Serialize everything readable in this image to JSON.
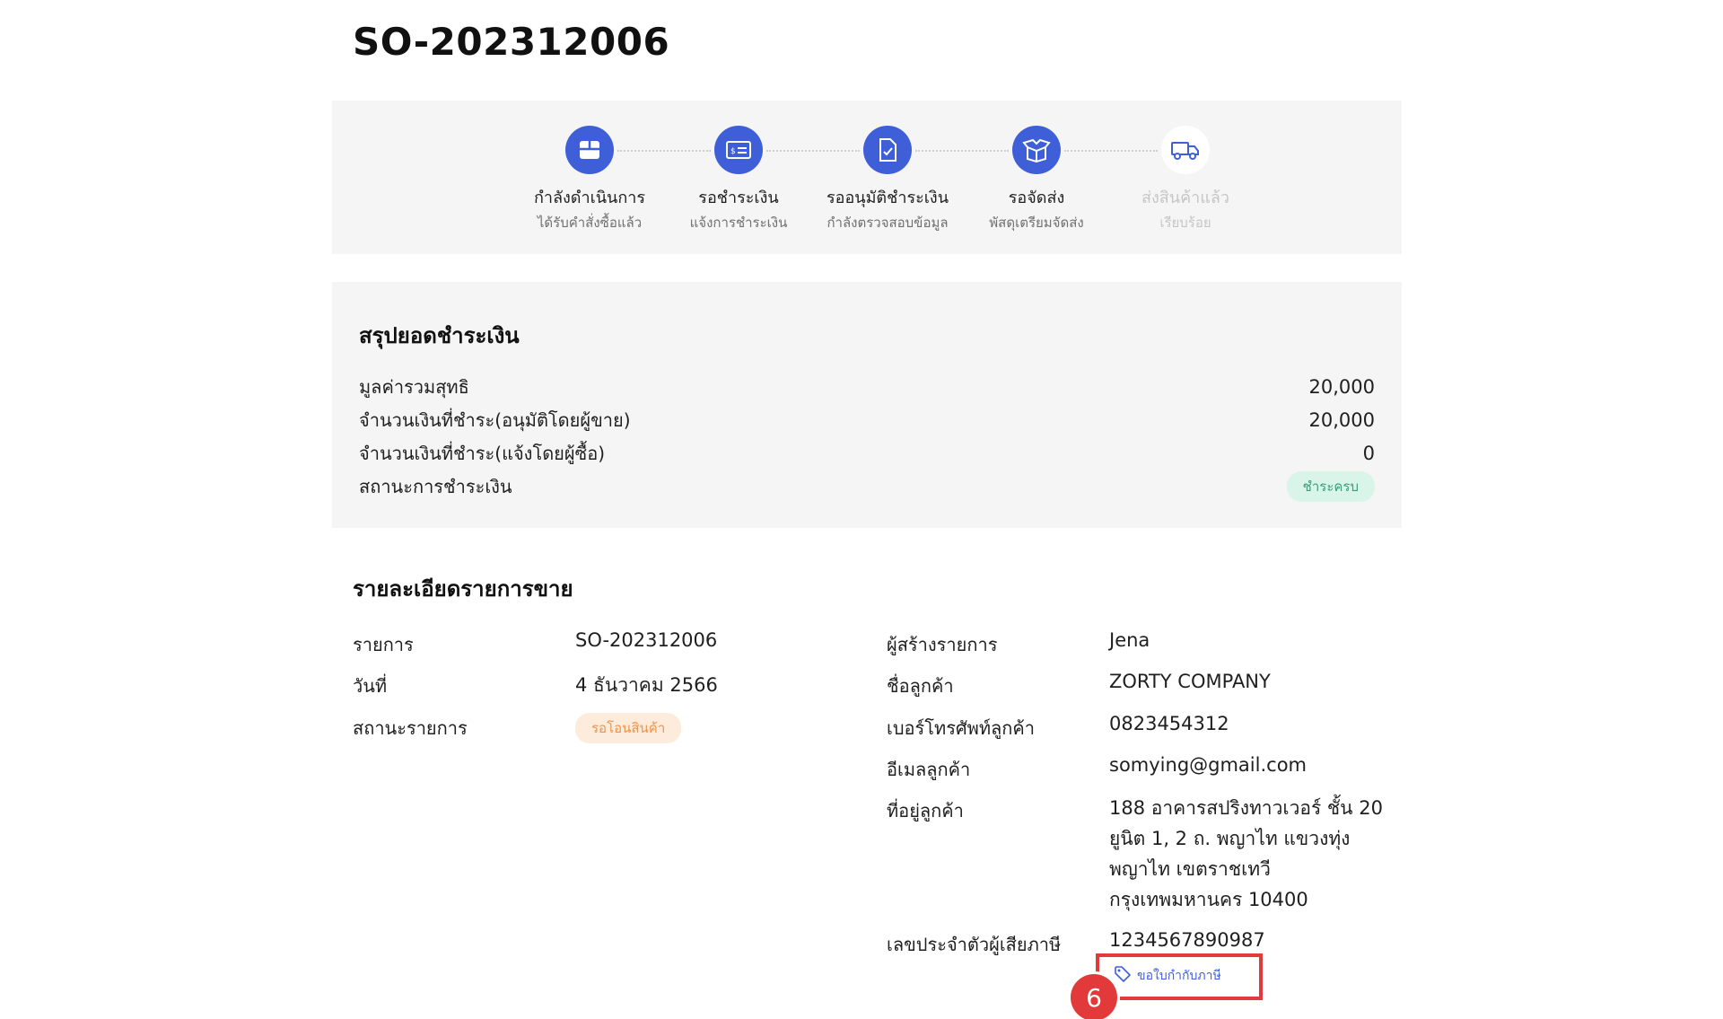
{
  "page": {
    "title": "SO-202312006"
  },
  "stepper": {
    "steps": [
      {
        "title": "กำลังดำเนินการ",
        "subtitle": "ได้รับคำสั่งซื้อแล้ว",
        "icon": "box-icon",
        "active": true
      },
      {
        "title": "รอชำระเงิน",
        "subtitle": "แจ้งการชำระเงิน",
        "icon": "payment-card-icon",
        "active": true
      },
      {
        "title": "รออนุมัติชำระเงิน",
        "subtitle": "กำลังตรวจสอบข้อมูล",
        "icon": "document-check-icon",
        "active": true
      },
      {
        "title": "รอจัดส่ง",
        "subtitle": "พัสดุเตรียมจัดส่ง",
        "icon": "open-box-icon",
        "active": true
      },
      {
        "title": "ส่งสินค้าแล้ว",
        "subtitle": "เรียบร้อย",
        "icon": "truck-icon",
        "active": false
      }
    ]
  },
  "summary": {
    "title": "สรุปยอดชำระเงิน",
    "rows": [
      {
        "label": "มูลค่ารวมสุทธิ",
        "value": "20,000"
      },
      {
        "label": "จำนวนเงินที่ชำระ(อนุมัติโดยผู้ขาย)",
        "value": "20,000"
      },
      {
        "label": "จำนวนเงินที่ชำระ(แจ้งโดยผู้ซื้อ)",
        "value": "0"
      }
    ],
    "status_label": "สถานะการชำระเงิน",
    "status_badge": "ชำระครบ"
  },
  "detail": {
    "title": "รายละเอียดรายการขาย",
    "left": {
      "order_label": "รายการ",
      "order_value": "SO-202312006",
      "date_label": "วันที่",
      "date_value": "4 ธันวาคม 2566",
      "status_label": "สถานะรายการ",
      "status_badge": "รอโอนสินค้า"
    },
    "right": {
      "creator_label": "ผู้สร้างรายการ",
      "creator_value": "Jena",
      "customer_label": "ชื่อลูกค้า",
      "customer_value": "ZORTY COMPANY",
      "phone_label": "เบอร์โทรศัพท์ลูกค้า",
      "phone_value": "0823454312",
      "email_label": "อีเมลลูกค้า",
      "email_value": "somying@gmail.com",
      "address_label": "ที่อยู่ลูกค้า",
      "address_lines": [
        "188 อาคารสปริงทาวเวอร์ ชั้น 20",
        "ยูนิต 1, 2 ถ. พญาไท แขวงทุ่ง",
        "พญาไท เขตราชเทวี",
        "กรุงเทพมหานคร 10400"
      ],
      "taxid_label": "เลขประจำตัวผู้เสียภาษี",
      "taxid_value": "1234567890987"
    },
    "tax_invoice_button": "ขอใบกำกับภาษี"
  },
  "annotation": {
    "step_number": "6"
  },
  "colors": {
    "accent": "#3f5fd8",
    "paid_badge_bg": "#d9f5ea",
    "paid_badge_text": "#3c9c7a",
    "pending_badge_bg": "#fdebdc",
    "pending_badge_text": "#e8954f",
    "highlight": "#e23a3a"
  }
}
